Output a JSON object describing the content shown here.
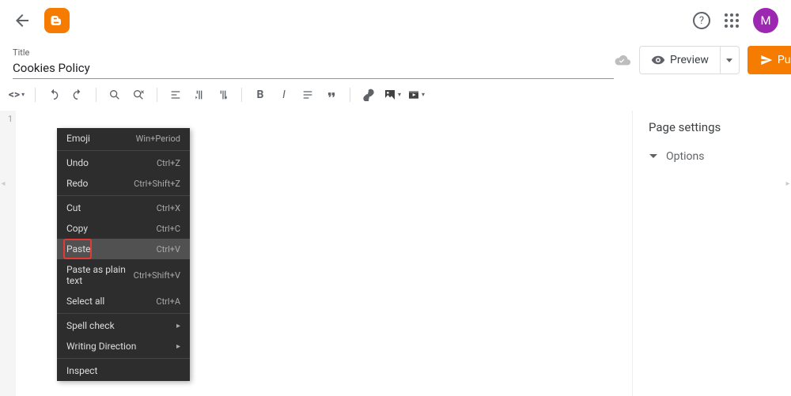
{
  "header": {
    "avatar_letter": "M"
  },
  "title": {
    "label": "Title",
    "value": "Cookies Policy"
  },
  "actions": {
    "preview_label": "Preview",
    "publish_label": "Publish"
  },
  "gutter": {
    "line1": "1"
  },
  "side": {
    "settings_label": "Page settings",
    "options_label": "Options"
  },
  "context_menu": {
    "items": [
      {
        "label": "Emoji",
        "shortcut": "Win+Period"
      },
      {
        "sep": true
      },
      {
        "label": "Undo",
        "shortcut": "Ctrl+Z"
      },
      {
        "label": "Redo",
        "shortcut": "Ctrl+Shift+Z"
      },
      {
        "sep": true
      },
      {
        "label": "Cut",
        "shortcut": "Ctrl+X"
      },
      {
        "label": "Copy",
        "shortcut": "Ctrl+C"
      },
      {
        "label": "Paste",
        "shortcut": "Ctrl+V",
        "highlight": true,
        "red_box": true
      },
      {
        "label": "Paste as plain text",
        "shortcut": "Ctrl+Shift+V"
      },
      {
        "label": "Select all",
        "shortcut": "Ctrl+A"
      },
      {
        "sep": true
      },
      {
        "label": "Spell check",
        "submenu": true
      },
      {
        "label": "Writing Direction",
        "submenu": true
      },
      {
        "sep": true
      },
      {
        "label": "Inspect"
      }
    ]
  }
}
